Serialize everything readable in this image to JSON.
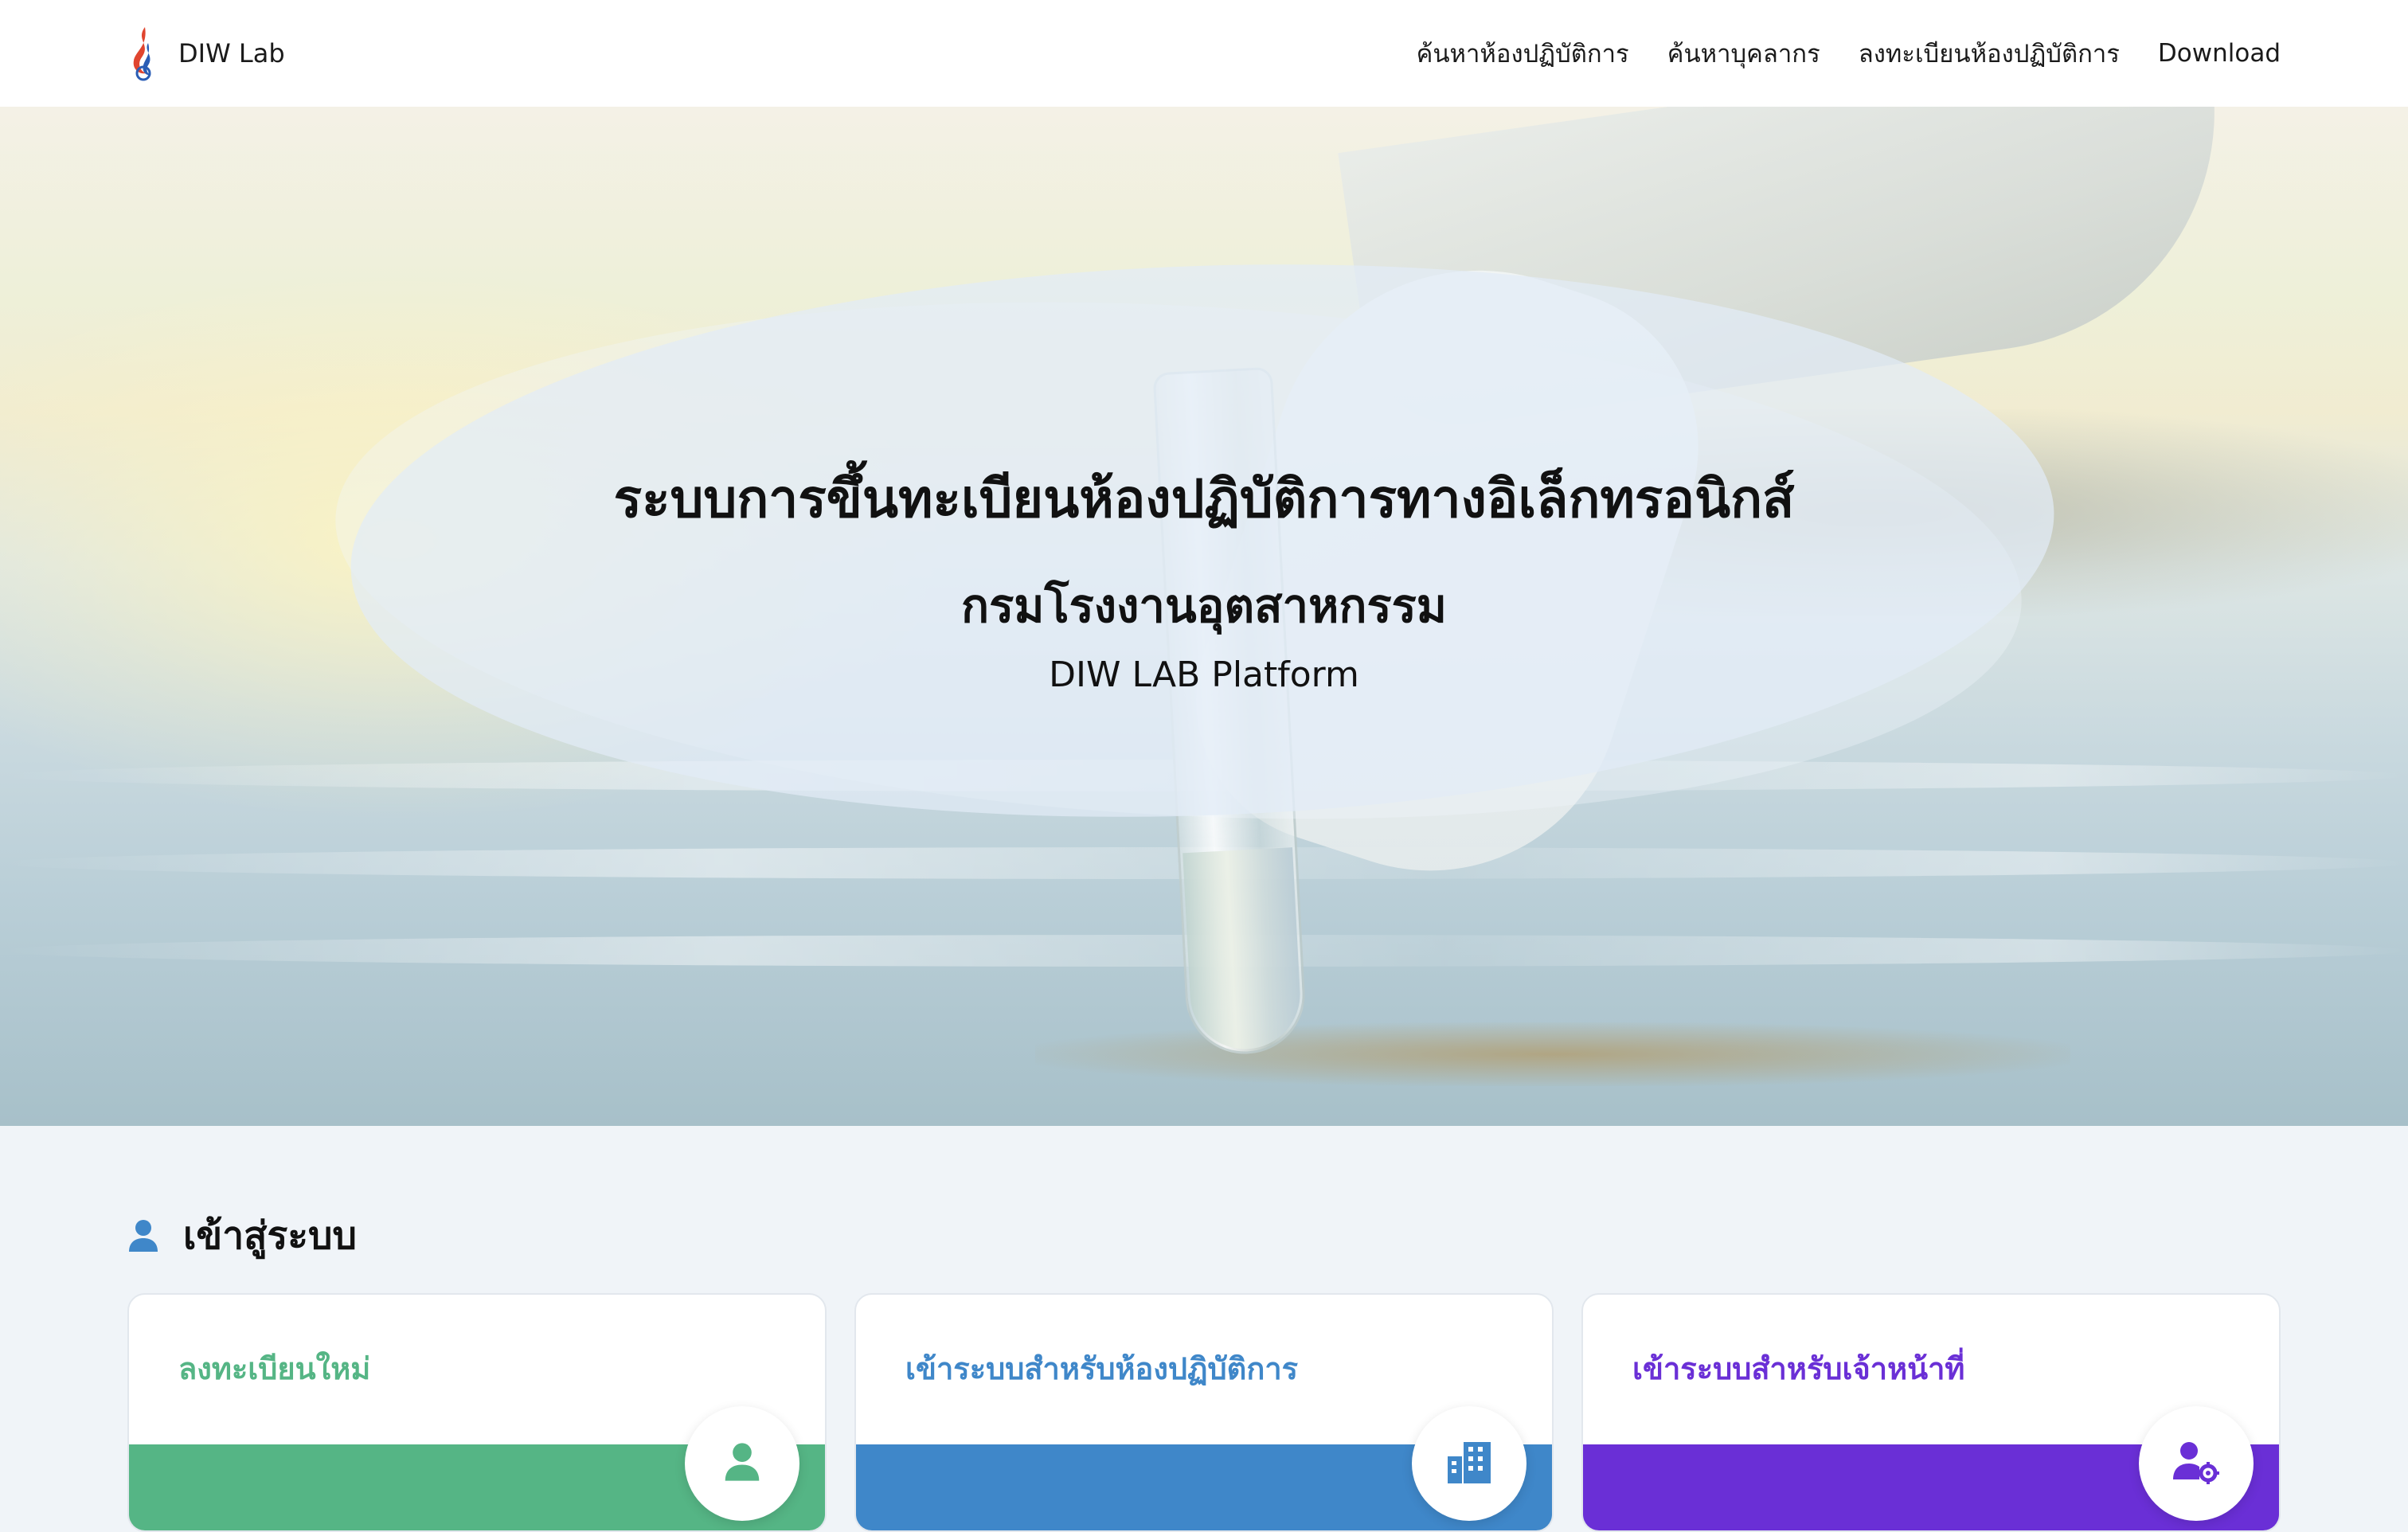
{
  "header": {
    "brand_name": "DIW Lab",
    "nav": [
      {
        "label": "ค้นหาห้องปฏิบัติการ"
      },
      {
        "label": "ค้นหาบุคลากร"
      },
      {
        "label": "ลงทะเบียนห้องปฏิบัติการ"
      },
      {
        "label": "Download"
      }
    ]
  },
  "hero": {
    "title": "ระบบการขึ้นทะเบียนห้องปฏิบัติการทางอิเล็กทรอนิกส์",
    "subtitle": "กรมโรงงานอุตสาหกรรม",
    "platform": "DIW LAB Platform"
  },
  "login": {
    "heading": "เข้าสู่ระบบ",
    "heading_icon": "user-icon",
    "cards": [
      {
        "title": "ลงทะเบียนใหม่",
        "color": "#55b585",
        "icon": "user-icon"
      },
      {
        "title": "เข้าระบบสำหรับห้องปฏิบัติการ",
        "color": "#3f87c9",
        "icon": "building-icon"
      },
      {
        "title": "เข้าระบบสำหรับเจ้าหน้าที่",
        "color": "#6a2fd6",
        "icon": "user-gear-icon"
      }
    ]
  },
  "colors": {
    "heading_icon": "#3f87c9",
    "background": "#f0f4f8"
  }
}
